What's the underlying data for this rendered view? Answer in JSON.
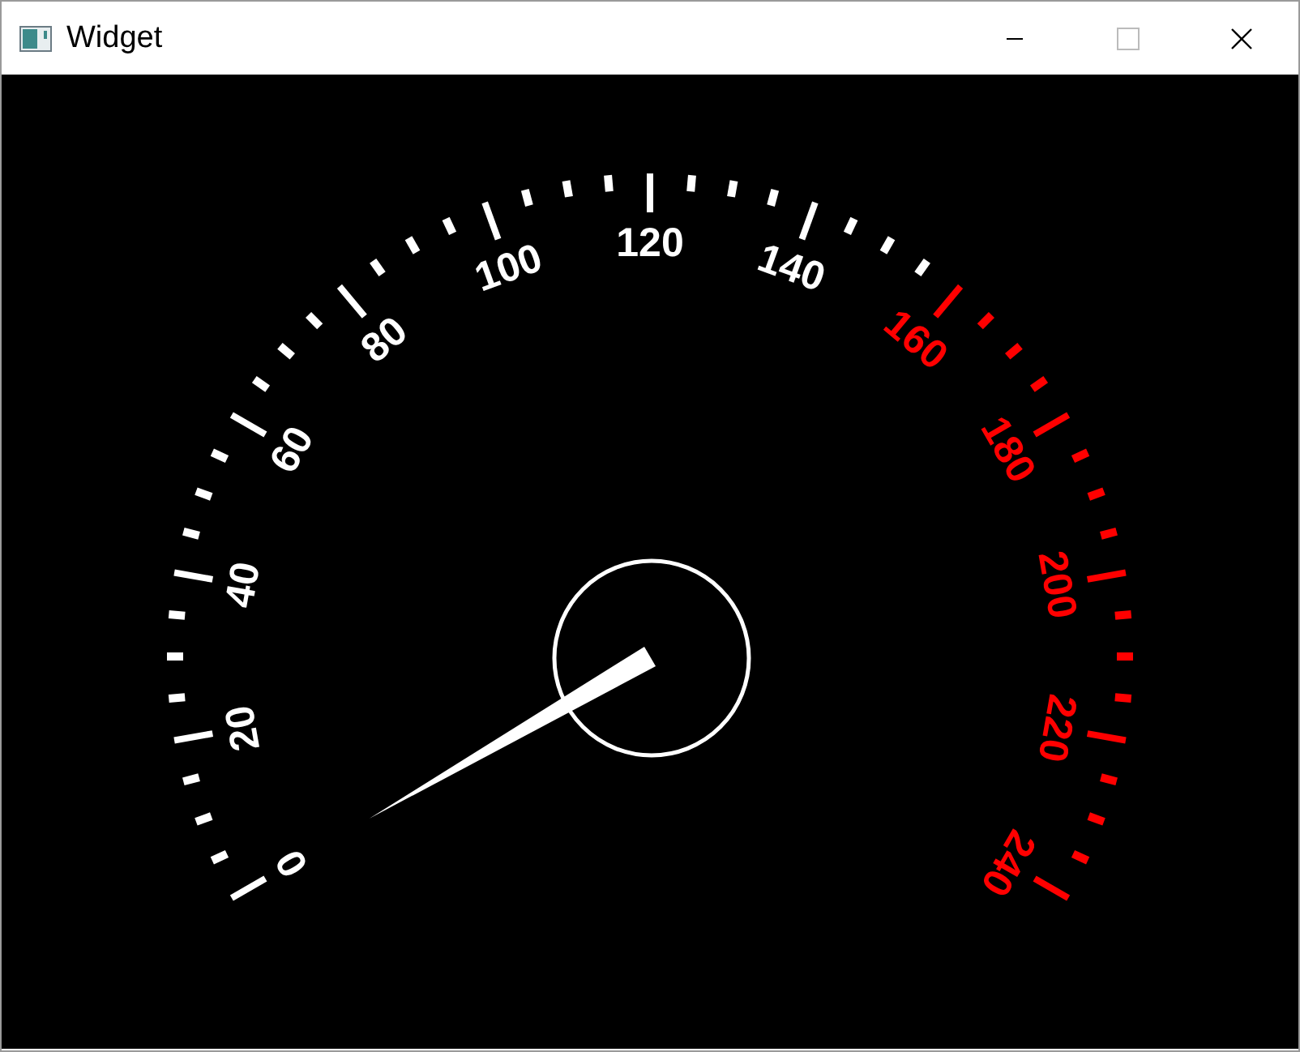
{
  "window": {
    "title": "Widget"
  },
  "gauge": {
    "labels": [
      {
        "text": "0",
        "color": "#ffffff"
      },
      {
        "text": "20",
        "color": "#ffffff"
      },
      {
        "text": "40",
        "color": "#ffffff"
      },
      {
        "text": "60",
        "color": "#ffffff"
      },
      {
        "text": "80",
        "color": "#ffffff"
      },
      {
        "text": "100",
        "color": "#ffffff"
      },
      {
        "text": "120",
        "color": "#ffffff"
      },
      {
        "text": "140",
        "color": "#ffffff"
      },
      {
        "text": "160",
        "color": "#ff0000"
      },
      {
        "text": "180",
        "color": "#ff0000"
      },
      {
        "text": "200",
        "color": "#ff0000"
      },
      {
        "text": "220",
        "color": "#ff0000"
      },
      {
        "text": "240",
        "color": "#ff0000"
      }
    ]
  }
}
